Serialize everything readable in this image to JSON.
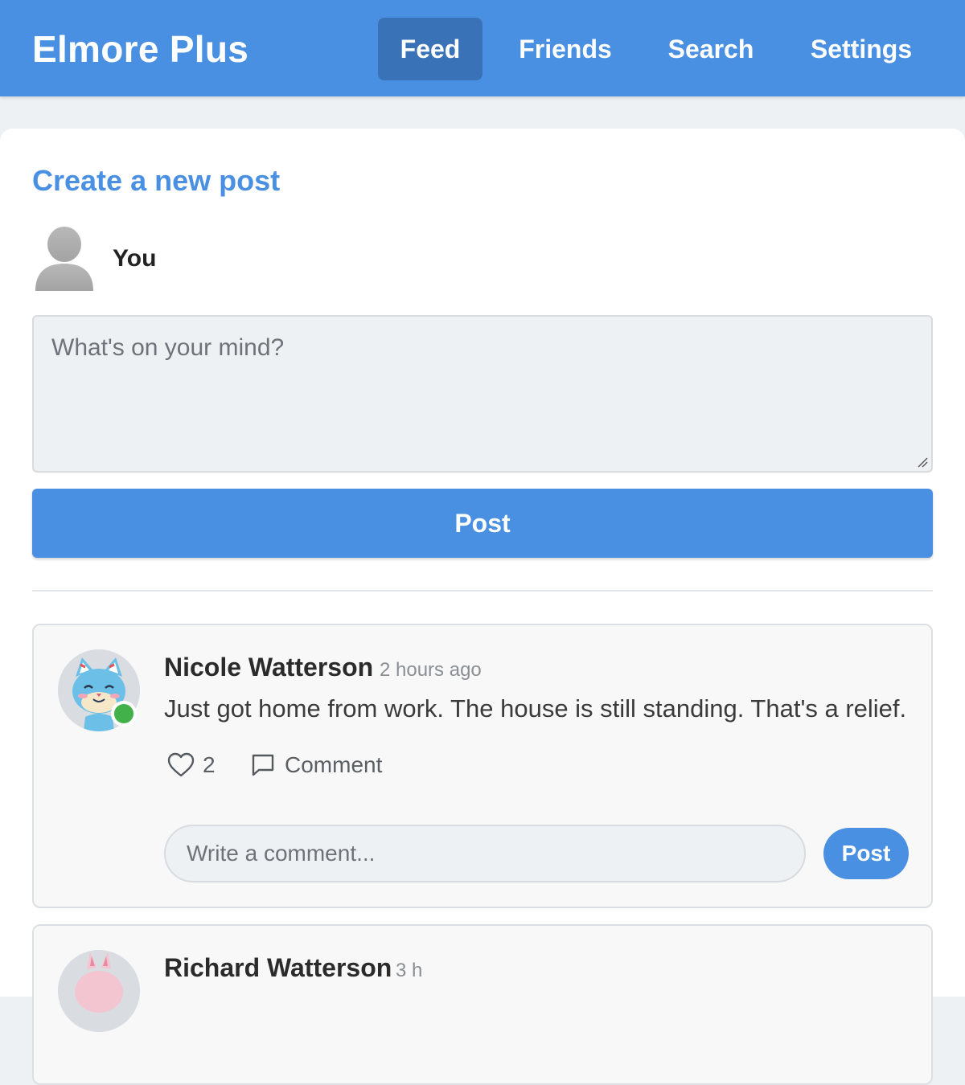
{
  "header": {
    "brand": "Elmore Plus",
    "nav": [
      {
        "label": "Feed",
        "active": true
      },
      {
        "label": "Friends",
        "active": false
      },
      {
        "label": "Search",
        "active": false
      },
      {
        "label": "Settings",
        "active": false
      }
    ]
  },
  "composer": {
    "title": "Create a new post",
    "user_name": "You",
    "placeholder": "What's on your mind?",
    "post_label": "Post"
  },
  "feed": [
    {
      "author": "Nicole Watterson",
      "time": "2 hours ago",
      "text": "Just got home from work. The house is still standing. That's a relief.",
      "likes": "2",
      "comment_label": "Comment",
      "comment_placeholder": "Write a comment...",
      "comment_post_label": "Post",
      "online": true
    },
    {
      "author": "Richard Watterson",
      "time": "3 h"
    }
  ],
  "colors": {
    "primary": "#4a90e2",
    "nav_active": "#3a72b8",
    "online": "#43b14a"
  },
  "icons": [
    "heart-icon",
    "comment-icon",
    "default-avatar-icon"
  ]
}
